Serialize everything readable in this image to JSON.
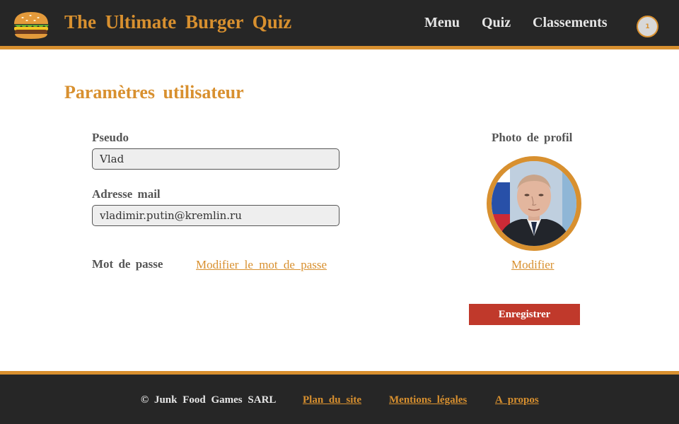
{
  "header": {
    "logo_icon": "burger-icon",
    "title": "The Ultimate Burger Quiz",
    "nav": {
      "menu": "Menu",
      "quiz": "Quiz",
      "classements": "Classements"
    },
    "user_badge": "1"
  },
  "main": {
    "page_title": "Paramètres utilisateur",
    "pseudo": {
      "label": "Pseudo",
      "value": "Vlad"
    },
    "email": {
      "label": "Adresse mail",
      "value": "vladimir.putin@kremlin.ru"
    },
    "password": {
      "label": "Mot de passe",
      "link": "Modifier le mot de passe"
    },
    "photo": {
      "label": "Photo de profil",
      "link": "Modifier"
    },
    "save_label": "Enregistrer"
  },
  "footer": {
    "copyright": "© Junk Food Games SARL",
    "sitemap": "Plan du site",
    "legal": "Mentions légales",
    "about": "A propos"
  },
  "colors": {
    "accent": "#d8902f",
    "header_bg": "#262626",
    "button_red": "#c0392b",
    "text_gray": "#555555"
  }
}
